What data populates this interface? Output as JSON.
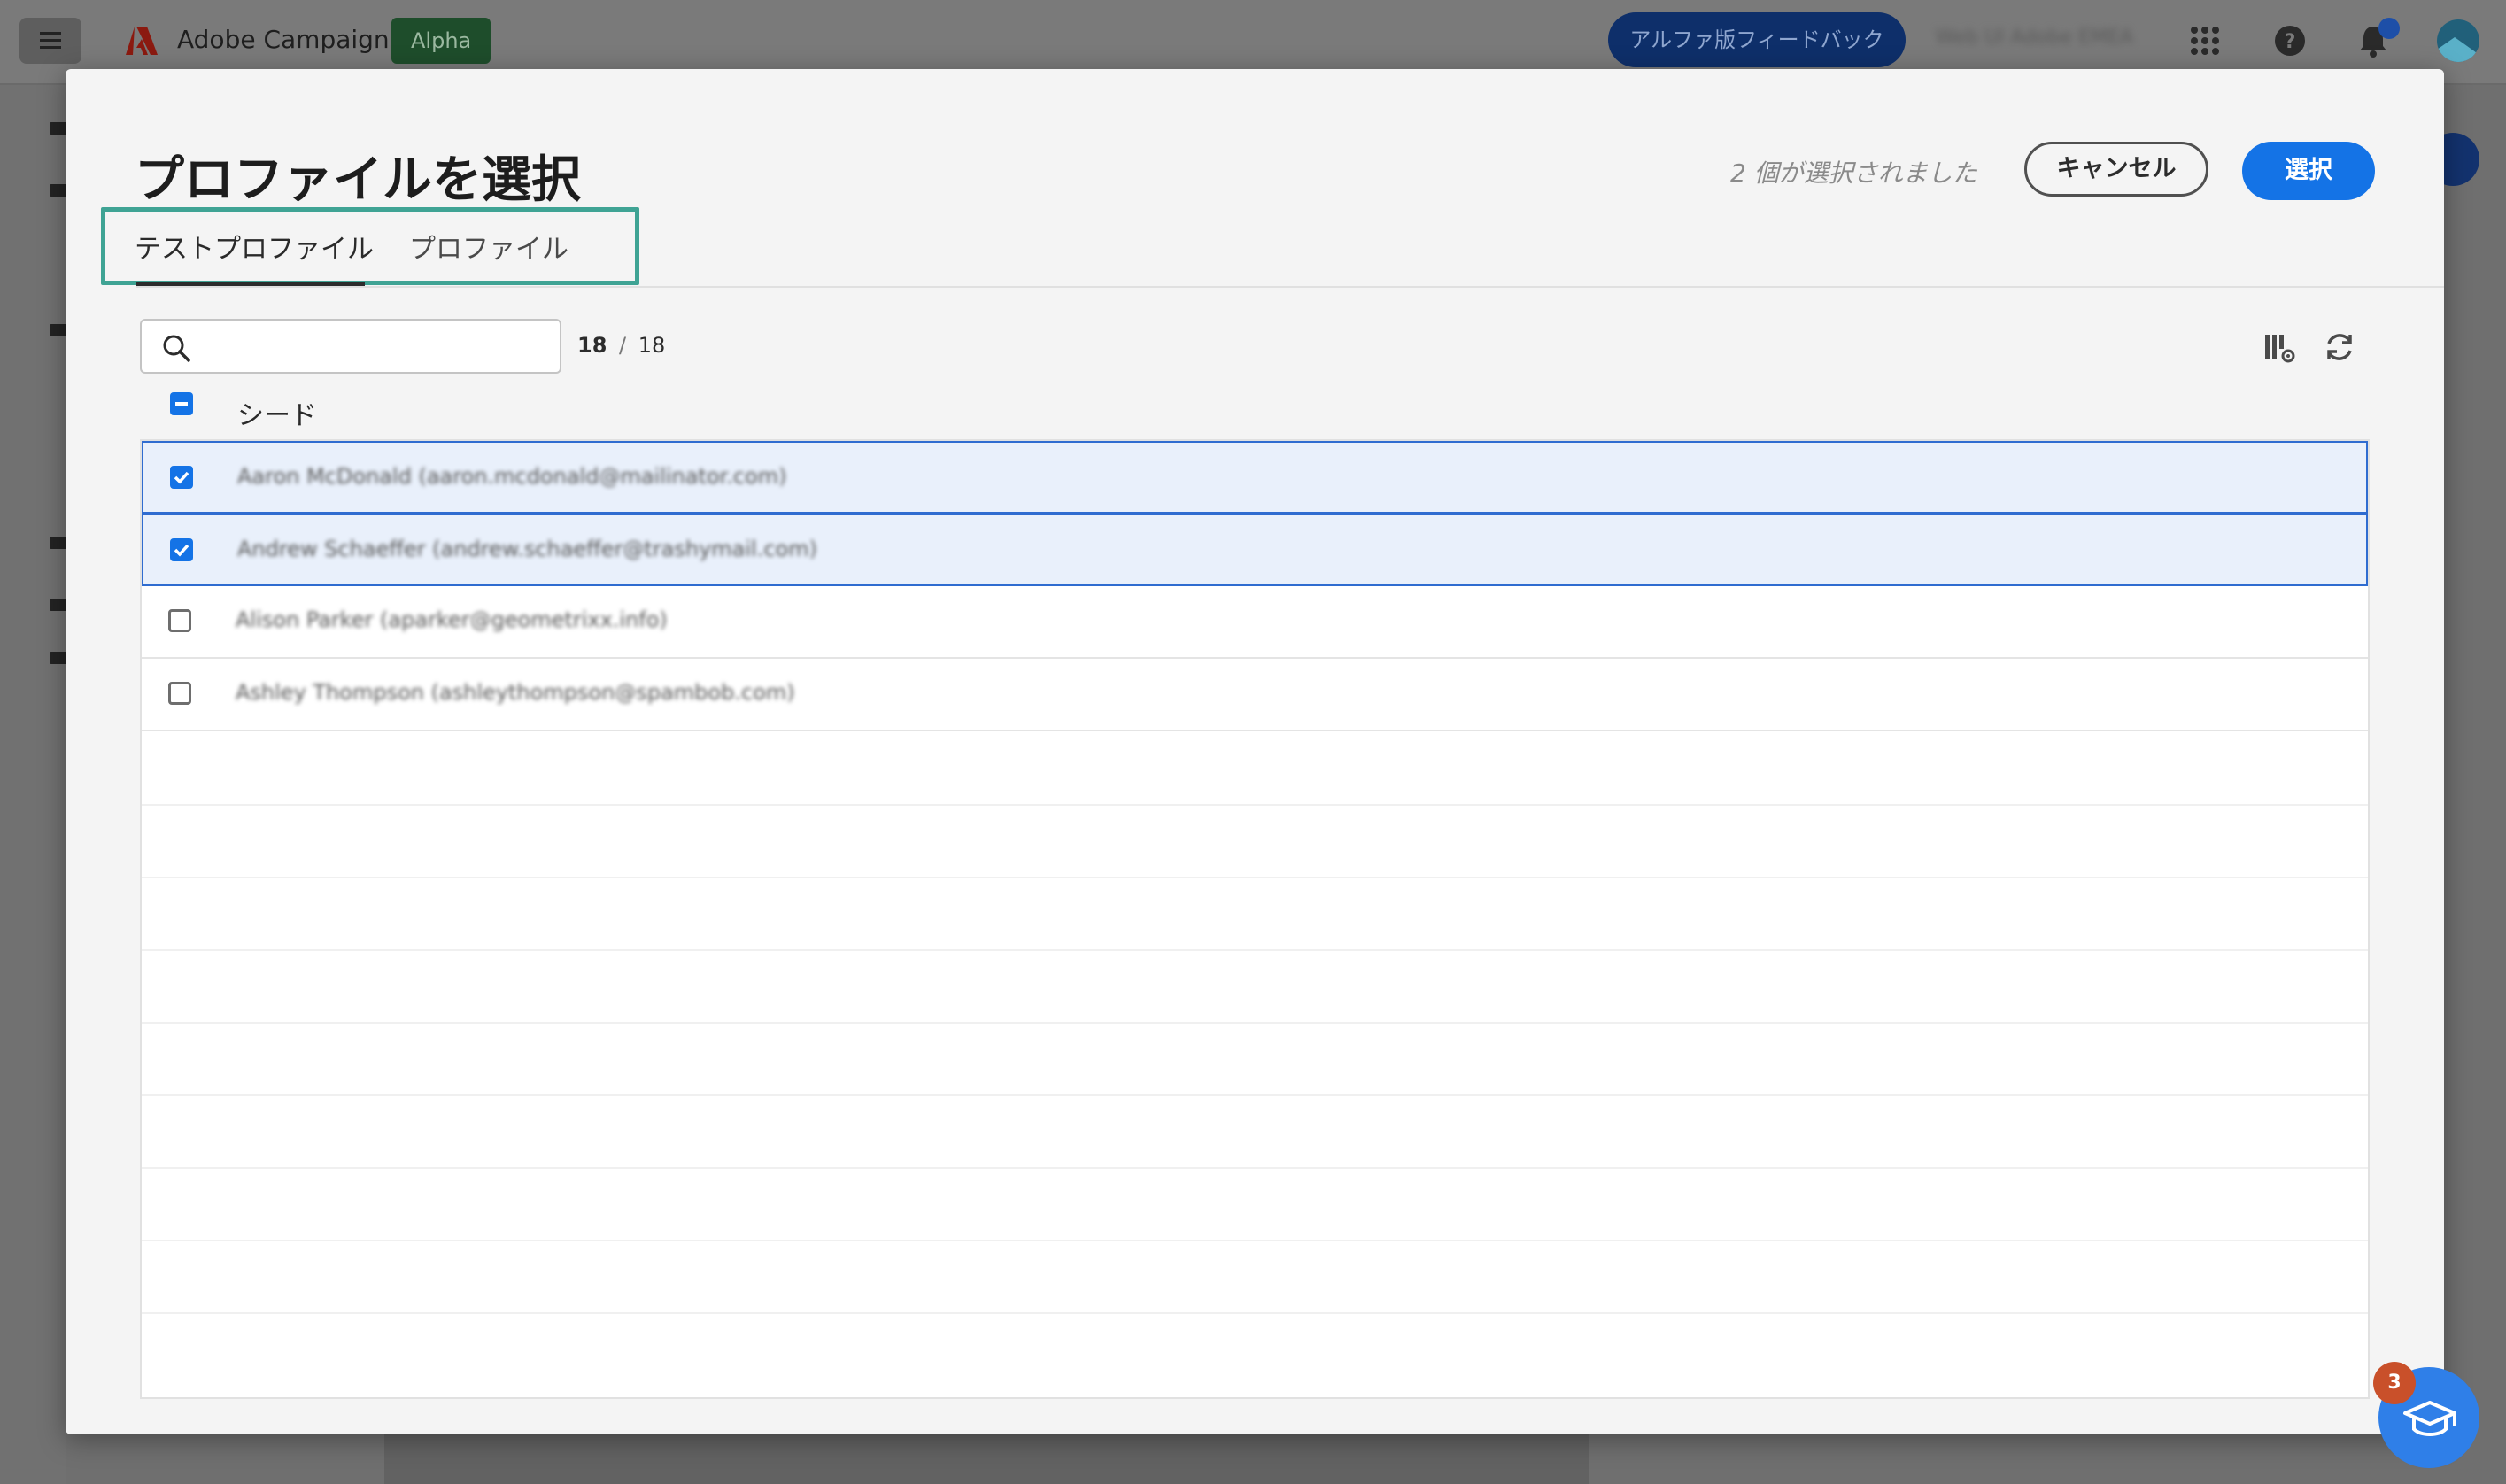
{
  "app": {
    "name": "Adobe Campaign",
    "badge": "Alpha",
    "feedback_label": "アルファ版フィードバック",
    "org_name": "Web UI Adobe EMEA"
  },
  "modal": {
    "title": "プロファイルを選択",
    "selected_count_text": "2 個が選択されました",
    "cancel_label": "キャンセル",
    "select_label": "選択",
    "tabs": [
      {
        "label": "テストプロファイル",
        "active": true
      },
      {
        "label": "プロファイル",
        "active": false
      }
    ],
    "search": {
      "value": "",
      "placeholder": ""
    },
    "count": {
      "shown": "18",
      "separator": "/",
      "total": "18"
    },
    "column_header": "シード",
    "rows": [
      {
        "text": "Aaron McDonald (aaron.mcdonald@mailinator.com)",
        "checked": true
      },
      {
        "text": "Andrew Schaeffer (andrew.schaeffer@trashymail.com)",
        "checked": true
      },
      {
        "text": "Alison Parker (aparker@geometrixx.info)",
        "checked": false
      },
      {
        "text": "Ashley Thompson (ashleythompson@spambob.com)",
        "checked": false
      }
    ]
  },
  "help_badge_count": "3",
  "colors": {
    "accent": "#1473e6",
    "highlight_frame": "#3fa394",
    "selected_row": "#e9f0fb"
  }
}
